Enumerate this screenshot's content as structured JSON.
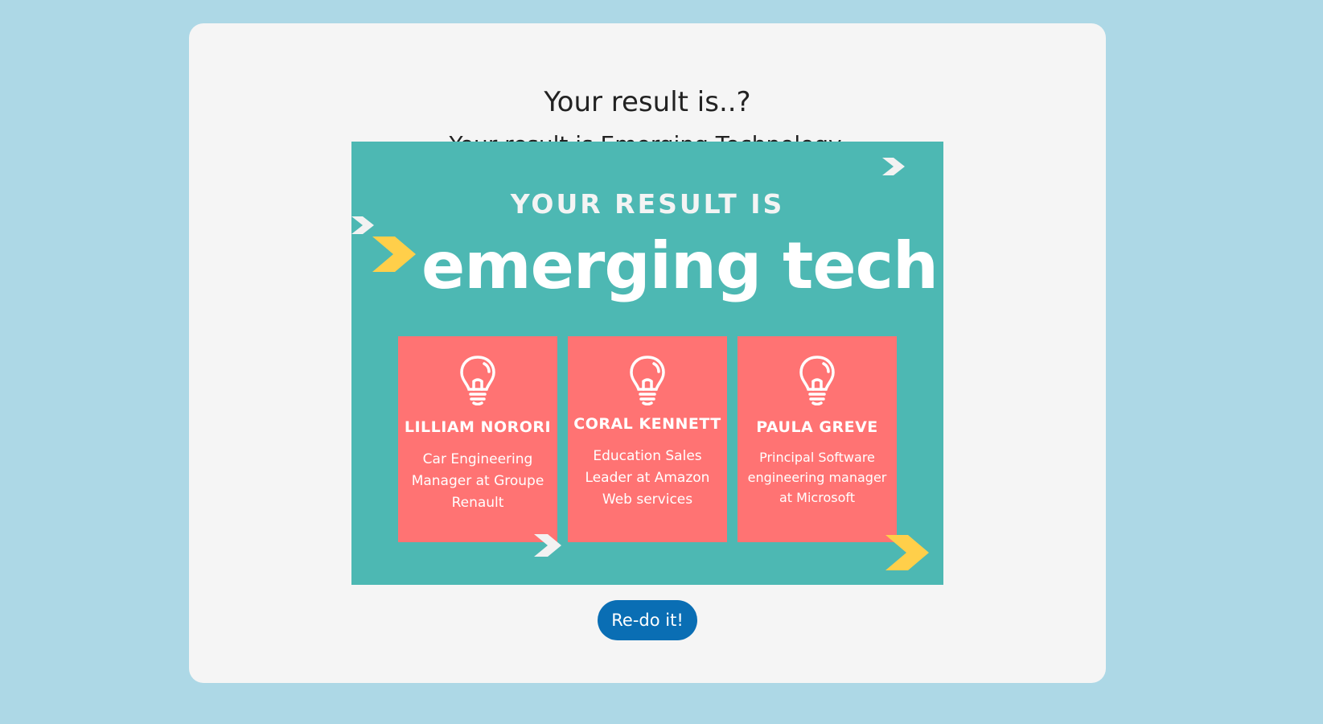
{
  "result": {
    "heading": "Your result is..?",
    "subheading": "Your result is Emerging Technology."
  },
  "image": {
    "title_small": "YOUR RESULT IS",
    "title_big": "emerging tech",
    "people": [
      {
        "name": "LILLIAM NORORI",
        "role": "Car Engineering Manager at Groupe Renault"
      },
      {
        "name": "CORAL KENNETT",
        "role": "Education Sales Leader at Amazon Web services"
      },
      {
        "name": "PAULA GREVE",
        "role": "Principal Software engineering manager at Microsoft"
      }
    ],
    "icon": "lightbulb-icon",
    "colors": {
      "background": "#4db8b3",
      "card": "#ff7373",
      "accent": "#ffcf4a",
      "arrow_white": "#f2f2f2"
    }
  },
  "actions": {
    "redo_label": "Re-do it!",
    "redo_color": "#0a6eb4"
  },
  "page": {
    "background": "#add8e6",
    "card_background": "#f5f5f5"
  }
}
